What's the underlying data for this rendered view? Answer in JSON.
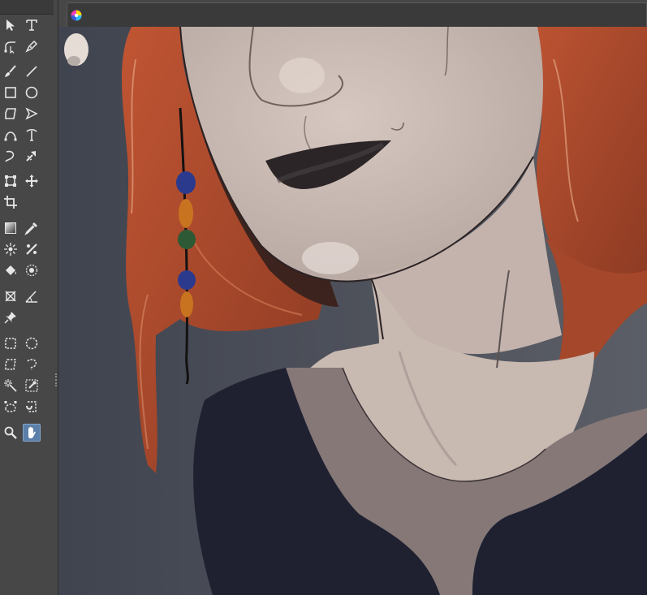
{
  "app": {
    "document_tab": {
      "icon": "color-wheel-icon",
      "label": ""
    },
    "active_tool": "hand-tool",
    "colors": {
      "panel": "#474747",
      "active_tool_bg": "#5a7fa8",
      "canvas_bg": "#3f4350",
      "hair": "#a8452a",
      "skin": "#cbbbb3",
      "collar": "#857877",
      "dress": "#1f2131"
    }
  },
  "toolbox": {
    "tools": [
      {
        "name": "selection-arrow-icon",
        "row": 0,
        "col": 0
      },
      {
        "name": "text-tool-icon",
        "row": 0,
        "col": 1
      },
      {
        "name": "node-edit-icon",
        "row": 1,
        "col": 0
      },
      {
        "name": "pen-tool-icon",
        "row": 1,
        "col": 1
      },
      {
        "name": "brush-icon",
        "row": 2,
        "col": 0
      },
      {
        "name": "line-tool-icon",
        "row": 2,
        "col": 1
      },
      {
        "name": "rectangle-tool-icon",
        "row": 3,
        "col": 0
      },
      {
        "name": "ellipse-tool-icon",
        "row": 3,
        "col": 1
      },
      {
        "name": "polygon-tool-icon",
        "row": 4,
        "col": 0
      },
      {
        "name": "polyline-tool-icon",
        "row": 4,
        "col": 1
      },
      {
        "name": "bezier-curve-icon",
        "row": 5,
        "col": 0
      },
      {
        "name": "curve-edit-icon",
        "row": 5,
        "col": 1
      },
      {
        "name": "spiral-curve-icon",
        "row": 6,
        "col": 0
      },
      {
        "name": "dynamic-brush-icon",
        "row": 6,
        "col": 1
      },
      {
        "name": "transform-icon",
        "row": 7,
        "col": 0
      },
      {
        "name": "move-icon",
        "row": 7,
        "col": 1
      },
      {
        "name": "crop-icon",
        "row": 8,
        "col": 0
      },
      {
        "name": "gradient-tool-icon",
        "row": 9,
        "col": 0
      },
      {
        "name": "eyedropper-icon",
        "row": 9,
        "col": 1
      },
      {
        "name": "smart-patch-icon",
        "row": 10,
        "col": 0
      },
      {
        "name": "multibrush-icon",
        "row": 10,
        "col": 1
      },
      {
        "name": "fill-bucket-icon",
        "row": 11,
        "col": 0
      },
      {
        "name": "enclose-fill-icon",
        "row": 11,
        "col": 1
      },
      {
        "name": "assistant-tool-icon",
        "row": 12,
        "col": 0
      },
      {
        "name": "measure-tool-icon",
        "row": 12,
        "col": 1
      },
      {
        "name": "reference-pin-icon",
        "row": 13,
        "col": 0
      },
      {
        "name": "rect-select-icon",
        "row": 14,
        "col": 0
      },
      {
        "name": "ellipse-select-icon",
        "row": 14,
        "col": 1
      },
      {
        "name": "polygon-select-icon",
        "row": 15,
        "col": 0
      },
      {
        "name": "freehand-select-icon",
        "row": 15,
        "col": 1
      },
      {
        "name": "magic-wand-icon",
        "row": 16,
        "col": 0
      },
      {
        "name": "similar-color-select-icon",
        "row": 16,
        "col": 1
      },
      {
        "name": "bezier-select-icon",
        "row": 17,
        "col": 0
      },
      {
        "name": "magnetic-select-icon",
        "row": 17,
        "col": 1
      },
      {
        "name": "zoom-icon",
        "row": 18,
        "col": 0
      },
      {
        "name": "hand-tool",
        "row": 18,
        "col": 1
      }
    ]
  }
}
